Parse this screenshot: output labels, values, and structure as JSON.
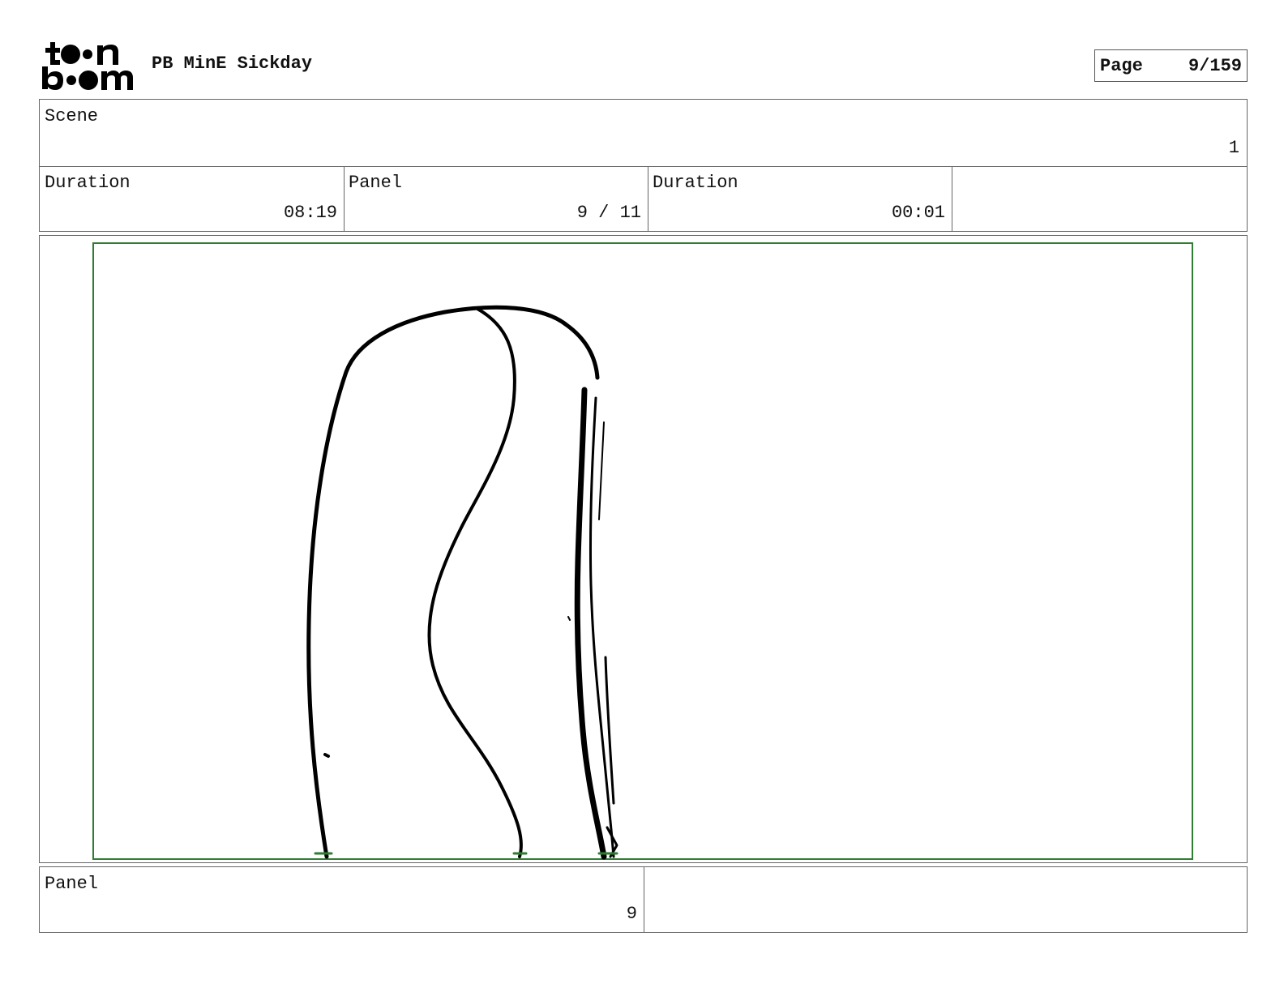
{
  "header": {
    "project_title": "PB MinE Sickday",
    "page_label": "Page",
    "page_value": "9/159"
  },
  "scene": {
    "label": "Scene",
    "value": "1"
  },
  "info_row": {
    "duration_label": "Duration",
    "duration_value": "08:19",
    "panel_label": "Panel",
    "panel_value": "9 / 11",
    "panel_duration_label": "Duration",
    "panel_duration_value": "00:01",
    "extra": ""
  },
  "footer": {
    "panel_label": "Panel",
    "panel_value": "9",
    "notes": ""
  },
  "colors": {
    "safe_area": "#2e7d32",
    "ink": "#000000",
    "frame": "#666666"
  }
}
